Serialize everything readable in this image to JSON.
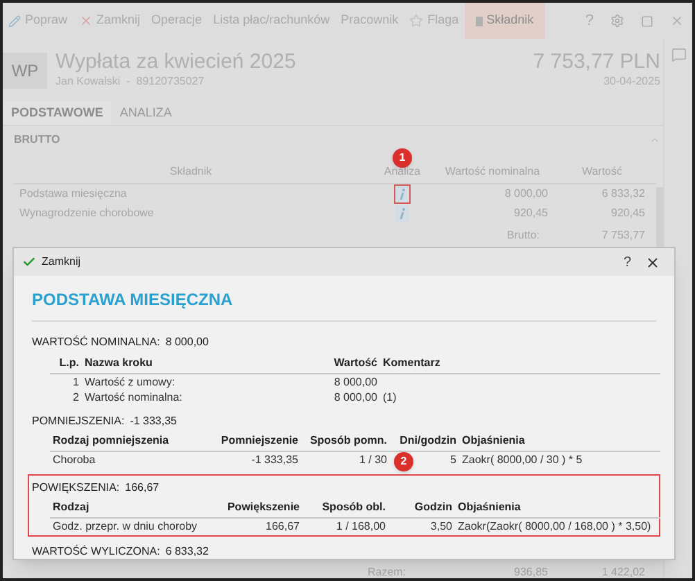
{
  "toolbar": {
    "items": [
      {
        "label": "Popraw",
        "highlighted": false
      },
      {
        "label": "Zamknij",
        "highlighted": false
      },
      {
        "label": "Operacje",
        "highlighted": false
      },
      {
        "label": "Lista płac/rachunków",
        "highlighted": false
      },
      {
        "label": "Pracownik",
        "highlighted": false
      },
      {
        "label": "Flaga",
        "highlighted": false
      },
      {
        "label": "Składnik",
        "highlighted": true
      }
    ],
    "help": "?"
  },
  "header": {
    "avatar": "WP",
    "title": "Wypłata za kwiecień 2025",
    "subtitle": "Jan Kowalski  -  89120735027",
    "amount": "7 753,77 PLN",
    "date": "30-04-2025"
  },
  "tabs": [
    {
      "label": "PODSTAWOWE",
      "selected": true
    },
    {
      "label": "ANALIZA",
      "selected": false
    }
  ],
  "section": "BRUTTO",
  "table": {
    "columns": [
      "Składnik",
      "Analiza",
      "Wartość nominalna",
      "Wartość"
    ],
    "rows": [
      {
        "name": "Podstawa miesięczna",
        "nominal": "8 000,00",
        "value": "6 833,32"
      },
      {
        "name": "Wynagrodzenie chorobowe",
        "nominal": "920,45",
        "value": "920,45"
      }
    ],
    "total": {
      "label": "Brutto:",
      "value": "7 753,77"
    },
    "footer": {
      "label": "Razem:",
      "nominal": "936,85",
      "value": "1 422,02"
    }
  },
  "dialog": {
    "close_label": "Zamknij",
    "help": "?",
    "title": "PODSTAWA MIESIĘCZNA",
    "nominal": {
      "label": "WARTOŚĆ NOMINALNA:",
      "value": "8 000,00",
      "columns": [
        "L.p.",
        "Nazwa kroku",
        "Wartość",
        "Komentarz"
      ],
      "rows": [
        [
          "1",
          "Wartość z umowy:",
          "8 000,00",
          ""
        ],
        [
          "2",
          "Wartość nominalna:",
          "8 000,00",
          "(1)"
        ]
      ]
    },
    "reductions": {
      "label": "POMNIEJSZENIA:",
      "value": "-1 333,35",
      "highlighted": false,
      "columns": [
        "Rodzaj pomniejszenia",
        "Pomniejszenie",
        "Sposób pomn.",
        "Dni/godzin",
        "Objaśnienia"
      ],
      "rows": [
        [
          "Choroba",
          "-1 333,35",
          "1 / 30",
          "5",
          "Zaokr( 8000,00 / 30 ) * 5"
        ]
      ]
    },
    "increases": {
      "label": "POWIĘKSZENIA:",
      "value": "166,67",
      "highlighted": true,
      "columns": [
        "Rodzaj",
        "Powiększenie",
        "Sposób obl.",
        "Godzin",
        "Objaśnienia"
      ],
      "rows": [
        [
          "Godz. przepr. w dniu choroby",
          "166,67",
          "1 / 168,00",
          "3,50",
          "Zaokr(Zaokr( 8000,00 / 168,00 ) * 3,50)"
        ]
      ]
    },
    "computed": {
      "label": "WARTOŚĆ WYLICZONA:",
      "value": "6 833,32"
    }
  },
  "callouts": [
    "1",
    "2"
  ]
}
